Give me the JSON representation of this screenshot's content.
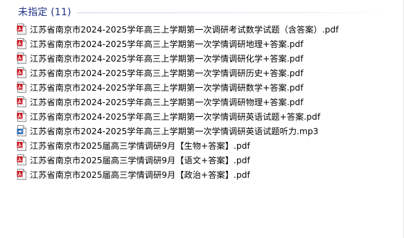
{
  "group": {
    "title": "未指定 (11)"
  },
  "files": [
    {
      "name": "江苏省南京市2024-2025学年高三上学期第一次调研考试数学试题（含答案）.pdf",
      "icon": "pdf-icon"
    },
    {
      "name": "江苏省南京市2024-2025学年高三上学期第一次学情调研地理+答案.pdf",
      "icon": "pdf-icon"
    },
    {
      "name": "江苏省南京市2024-2025学年高三上学期第一次学情调研化学+答案.pdf",
      "icon": "pdf-icon"
    },
    {
      "name": "江苏省南京市2024-2025学年高三上学期第一次学情调研历史+答案.pdf",
      "icon": "pdf-icon"
    },
    {
      "name": "江苏省南京市2024-2025学年高三上学期第一次学情调研数学+答案.pdf",
      "icon": "pdf-icon"
    },
    {
      "name": "江苏省南京市2024-2025学年高三上学期第一次学情调研物理+答案.pdf",
      "icon": "pdf-icon"
    },
    {
      "name": "江苏省南京市2024-2025学年高三上学期第一次学情调研英语试题+答案.pdf",
      "icon": "pdf-icon"
    },
    {
      "name": "江苏省南京市2024-2025学年高三上学期第一次学情调研英语试题听力.mp3",
      "icon": "audio-file-icon"
    },
    {
      "name": "江苏省南京市2025届高三学情调研9月【生物+答案】.pdf",
      "icon": "pdf-icon"
    },
    {
      "name": "江苏省南京市2025届高三学情调研9月【语文+答案】.pdf",
      "icon": "pdf-icon"
    },
    {
      "name": "江苏省南京市2025届高三学情调研9月【政治+答案】.pdf",
      "icon": "pdf-icon"
    }
  ],
  "colors": {
    "group_title": "#1e3287",
    "pdf_icon": "#c8141e",
    "audio_icon": "#2f6db5"
  }
}
